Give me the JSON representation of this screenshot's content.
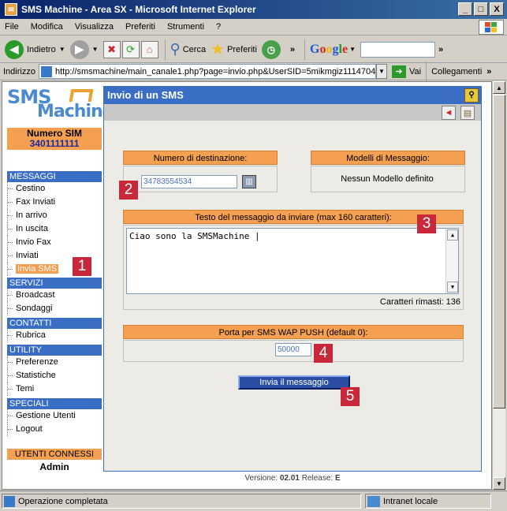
{
  "window": {
    "title": "SMS Machine - Area SX - Microsoft Internet Explorer",
    "minimize": "_",
    "maximize": "□",
    "close": "X"
  },
  "menu": [
    "File",
    "Modifica",
    "Visualizza",
    "Preferiti",
    "Strumenti",
    "?"
  ],
  "toolbar": {
    "back": "Indietro",
    "search": "Cerca",
    "favorites": "Preferiti",
    "google": "Google"
  },
  "address": {
    "label": "Indirizzo",
    "url": "http://smsmachine/main_canale1.php?page=invio.php&UserSID=5mikmgiz1114704",
    "go": "Vai",
    "links": "Collegamenti"
  },
  "sidebar": {
    "logo_top": "SMS",
    "logo_bottom": "Machine",
    "sim_label": "Numero SIM",
    "sim_number": "3401111111",
    "sections": [
      {
        "title": "MESSAGGI",
        "items": [
          "Cestino",
          "Fax Inviati",
          "In arrivo",
          "In uscita",
          "Invio Fax",
          "Inviati",
          "Invia SMS"
        ]
      },
      {
        "title": "SERVIZI",
        "items": [
          "Broadcast",
          "Sondaggi"
        ]
      },
      {
        "title": "CONTATTI",
        "items": [
          "Rubrica"
        ]
      },
      {
        "title": "UTILITY",
        "items": [
          "Preferenze",
          "Statistiche",
          "Temi"
        ]
      },
      {
        "title": "SPECIALI",
        "items": [
          "Gestione Utenti",
          "Logout"
        ]
      }
    ],
    "users_label": "UTENTI CONNESSI",
    "user_name": "Admin"
  },
  "main": {
    "title": "Invio di un SMS",
    "dest_label": "Numero di destinazione:",
    "dest_value": "34783554534",
    "models_label": "Modelli di Messaggio:",
    "models_value": "Nessun Modello definito",
    "text_label": "Testo del messaggio da inviare (max 160 caratteri):",
    "text_value": "Ciao sono la SMSMachine |",
    "chars_left": "Caratteri rimasti: 136",
    "port_label": "Porta per SMS WAP PUSH (default 0):",
    "port_value": "50000",
    "send_label": "Invia il messaggio"
  },
  "footer": {
    "version_label": "Versione:",
    "version": "02.01",
    "release_label": "Release:",
    "release": "E"
  },
  "markers": [
    "1",
    "2",
    "3",
    "4",
    "5"
  ],
  "status": {
    "text": "Operazione completata",
    "zone": "Intranet locale"
  }
}
